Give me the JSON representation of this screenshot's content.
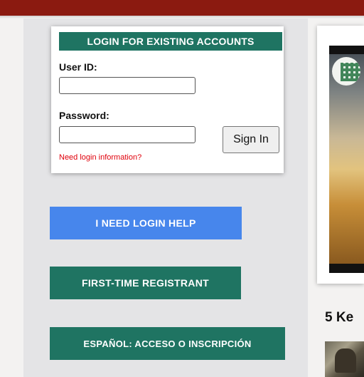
{
  "login": {
    "header": "LOGIN FOR EXISTING ACCOUNTS",
    "user_id_label": "User ID:",
    "user_id_value": "",
    "password_label": "Password:",
    "password_value": "",
    "sign_in_label": "Sign In",
    "help_link": "Need login information?"
  },
  "actions": {
    "login_help": "I NEED LOGIN HELP",
    "first_time": "FIRST-TIME REGISTRANT",
    "espanol": "ESPAÑOL: ACCESO O INSCRIPCIÓN"
  },
  "article": {
    "heading": "5 Ke"
  },
  "colors": {
    "top_bar": "#8b1a10",
    "accent_green": "#1f7462",
    "accent_blue": "#4786ec",
    "link_red": "#e0000b"
  },
  "icons": {
    "video_logo": "building-logo-icon"
  }
}
